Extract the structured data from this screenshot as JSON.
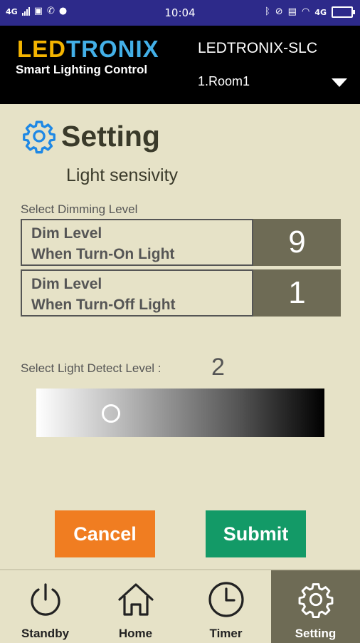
{
  "status_bar": {
    "network_left": "4G",
    "time": "10:04",
    "network_right": "4G"
  },
  "header": {
    "brand_part1": "LED",
    "brand_part2": "TRONIX",
    "brand_subtitle": "Smart Lighting Control",
    "device_name": "LEDTRONIX-SLC",
    "room_selected": "1.Room1"
  },
  "page": {
    "title": "Setting",
    "subtitle": "Light sensivity"
  },
  "dimming": {
    "section_label": "Select Dimming Level",
    "turn_on": {
      "line1": "Dim Level",
      "line2": "When Turn-On Light",
      "value": "9"
    },
    "turn_off": {
      "line1": "Dim Level",
      "line2": "When Turn-Off Light",
      "value": "1"
    }
  },
  "light_detect": {
    "label": "Select Light Detect Level :",
    "value": "2",
    "slider_position": 0.26
  },
  "buttons": {
    "cancel": "Cancel",
    "submit": "Submit"
  },
  "nav": {
    "items": [
      {
        "label": "Standby",
        "icon": "power-icon"
      },
      {
        "label": "Home",
        "icon": "home-icon"
      },
      {
        "label": "Timer",
        "icon": "clock-icon"
      },
      {
        "label": "Setting",
        "icon": "gear-icon",
        "active": true
      }
    ]
  },
  "colors": {
    "status_bar": "#2d2a8a",
    "brand_led": "#f4b400",
    "brand_tronix": "#43b0e8",
    "background": "#e6e2c7",
    "value_box": "#6e6b55",
    "cancel": "#f07d21",
    "submit": "#139a67",
    "gear_accent": "#1e88e5"
  }
}
